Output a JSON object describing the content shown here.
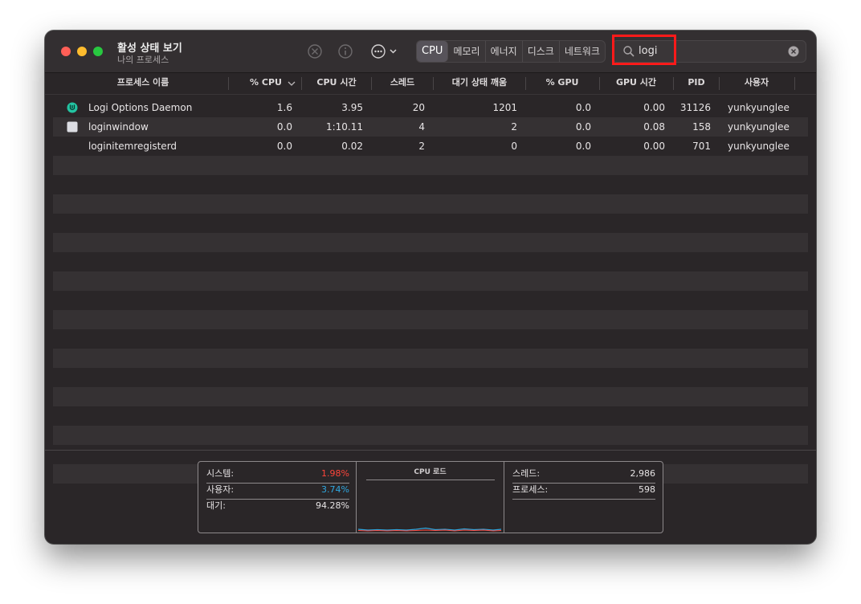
{
  "app": {
    "title": "활성 상태 보기",
    "subtitle": "나의 프로세스"
  },
  "toolbar": {
    "stop_icon": "stop-process-icon",
    "info_icon": "info-icon",
    "more_icon": "more-options-icon"
  },
  "tabs": [
    {
      "label": "CPU",
      "active": true
    },
    {
      "label": "메모리",
      "active": false
    },
    {
      "label": "에너지",
      "active": false
    },
    {
      "label": "디스크",
      "active": false
    },
    {
      "label": "네트워크",
      "active": false
    }
  ],
  "search": {
    "value": "logi",
    "icon": "search-icon",
    "clear_icon": "clear-icon"
  },
  "columns": [
    "프로세스 이름",
    "% CPU",
    "CPU 시간",
    "스레드",
    "대기 상태 깨움",
    "% GPU",
    "GPU 시간",
    "PID",
    "사용자"
  ],
  "processes": [
    {
      "name": "Logi Options Daemon",
      "icon": "logi-options-icon",
      "cpu": "1.6",
      "cpu_time": "3.95",
      "threads": "20",
      "wakeups": "1201",
      "gpu": "0.0",
      "gpu_time": "0.00",
      "pid": "31126",
      "user": "yunkyunglee"
    },
    {
      "name": "loginwindow",
      "icon": "loginwindow-icon",
      "cpu": "0.0",
      "cpu_time": "1:10.11",
      "threads": "4",
      "wakeups": "2",
      "gpu": "0.0",
      "gpu_time": "0.08",
      "pid": "158",
      "user": "yunkyunglee"
    },
    {
      "name": "loginitemregisterd",
      "icon": "",
      "cpu": "0.0",
      "cpu_time": "0.02",
      "threads": "2",
      "wakeups": "0",
      "gpu": "0.0",
      "gpu_time": "0.00",
      "pid": "701",
      "user": "yunkyunglee"
    }
  ],
  "summary": {
    "system_label": "시스템:",
    "system_value": "1.98%",
    "user_label": "사용자:",
    "user_value": "3.74%",
    "idle_label": "대기:",
    "idle_value": "94.28%",
    "load_title": "CPU 로드",
    "threads_label": "스레드:",
    "threads_value": "2,986",
    "processes_label": "프로세스:",
    "processes_value": "598"
  },
  "colors": {
    "system": "#ff453a",
    "user": "#2fa8e0",
    "highlight": "#ff1a1a"
  }
}
